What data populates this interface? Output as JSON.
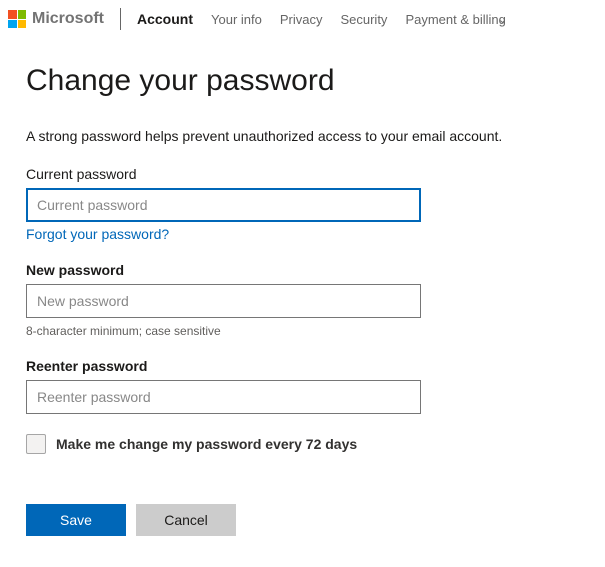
{
  "header": {
    "brand": "Microsoft",
    "nav": {
      "account": "Account",
      "your_info": "Your info",
      "privacy": "Privacy",
      "security": "Security",
      "payment_billing": "Payment & billing"
    }
  },
  "page": {
    "title": "Change your password",
    "subtitle": "A strong password helps prevent unauthorized access to your email account."
  },
  "form": {
    "current_password": {
      "label": "Current password",
      "placeholder": "Current password",
      "value": ""
    },
    "forgot_link": "Forgot your password?",
    "new_password": {
      "label": "New password",
      "placeholder": "New password",
      "value": "",
      "hint": "8-character minimum; case sensitive"
    },
    "reenter_password": {
      "label": "Reenter password",
      "placeholder": "Reenter password",
      "value": ""
    },
    "rotate_checkbox": {
      "label": "Make me change my password every 72 days",
      "checked": false
    },
    "buttons": {
      "save": "Save",
      "cancel": "Cancel"
    }
  }
}
